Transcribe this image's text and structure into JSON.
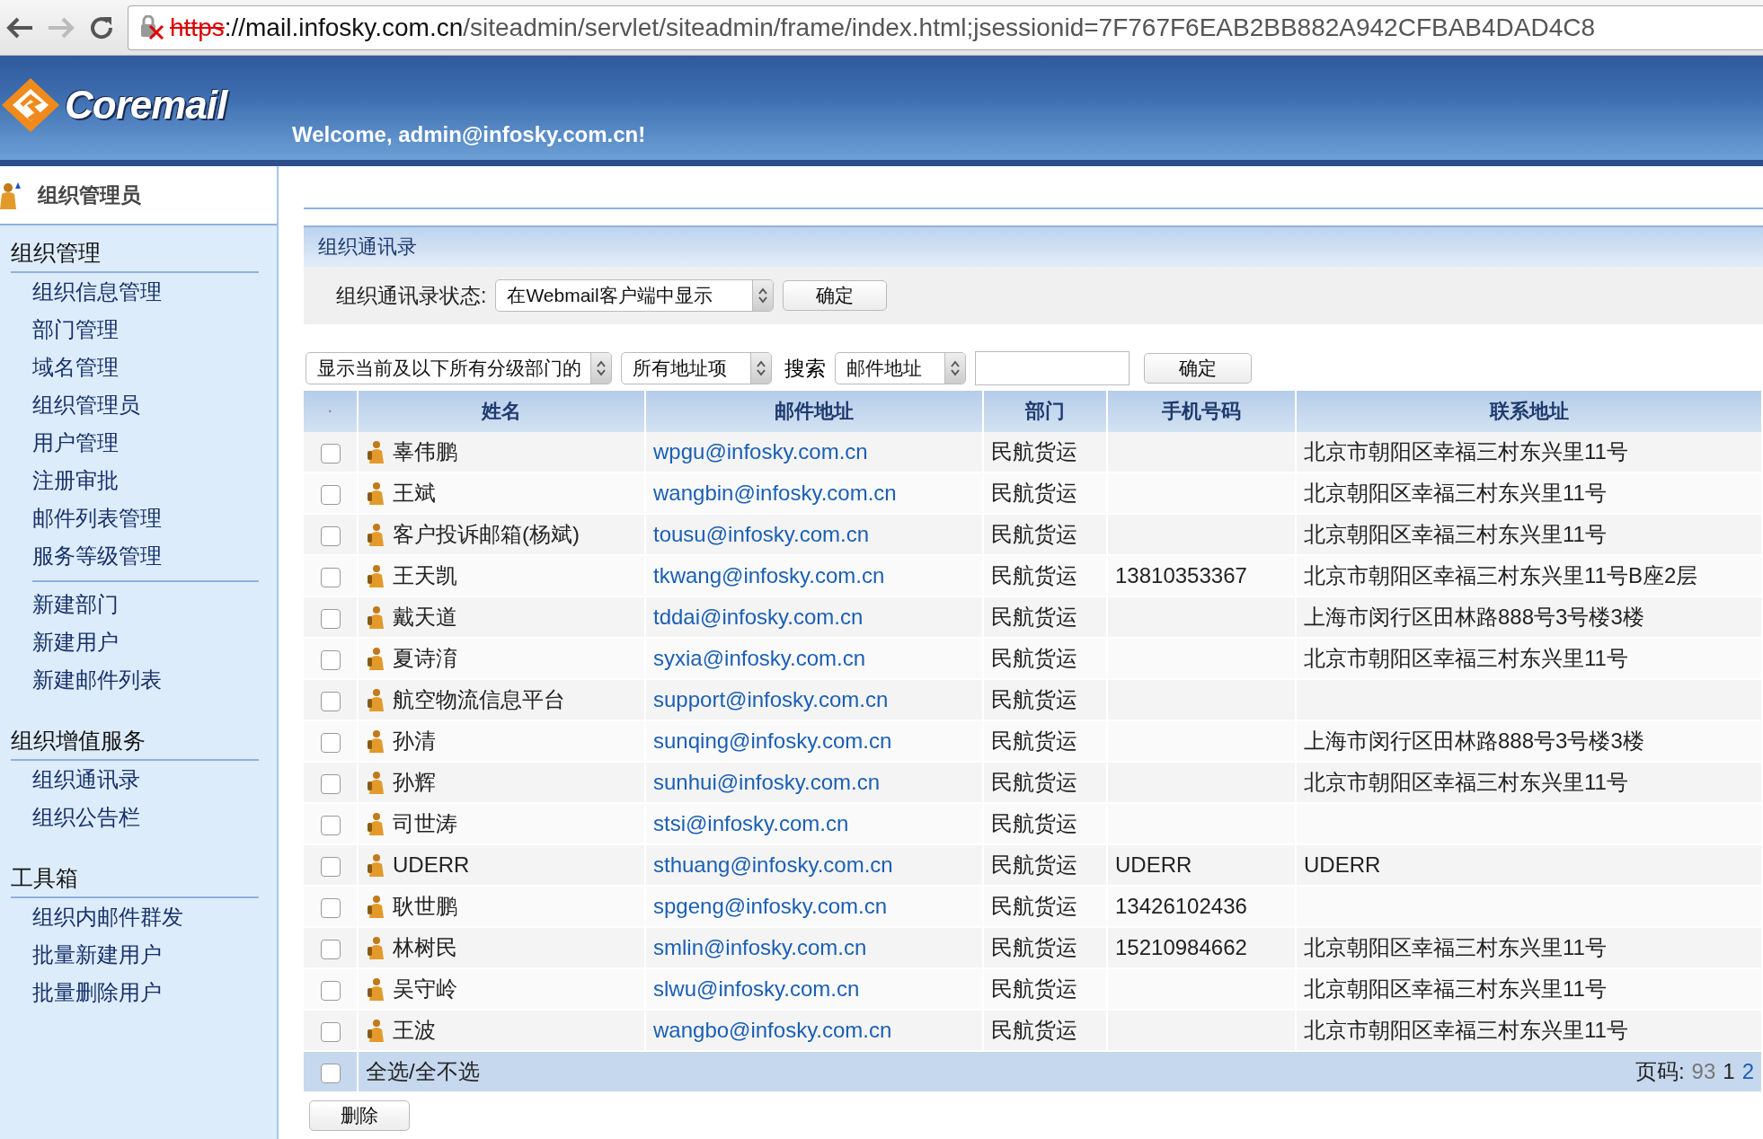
{
  "browser": {
    "url_scheme": "https",
    "url_host": "://mail.infosky.com.cn",
    "url_path": "/siteadmin/servlet/siteadmin/frame/index.html;jsessionid=7F767F6EAB2BB882A942CFBAB4DAD4C8"
  },
  "header": {
    "logo": "Coremail",
    "welcome": "Welcome, admin@infosky.com.cn!"
  },
  "sidebar": {
    "role": "组织管理员",
    "groups": [
      {
        "title": "组织管理",
        "items": [
          {
            "label": "组织信息管理"
          },
          {
            "label": "部门管理"
          },
          {
            "label": "域名管理"
          },
          {
            "label": "组织管理员"
          },
          {
            "label": "用户管理"
          },
          {
            "label": "注册审批"
          },
          {
            "label": "邮件列表管理"
          },
          {
            "label": "服务等级管理"
          }
        ],
        "items2": [
          {
            "label": "新建部门"
          },
          {
            "label": "新建用户"
          },
          {
            "label": "新建邮件列表"
          }
        ]
      },
      {
        "title": "组织增值服务",
        "items": [
          {
            "label": "组织通讯录"
          },
          {
            "label": "组织公告栏"
          }
        ]
      },
      {
        "title": "工具箱",
        "items": [
          {
            "label": "组织内邮件群发"
          },
          {
            "label": "批量新建用户"
          },
          {
            "label": "批量删除用户"
          }
        ]
      }
    ]
  },
  "panel": {
    "title": "组织通讯录",
    "status_label": "组织通讯录状态:",
    "status_value": "在Webmail客户端中显示",
    "status_button": "确定"
  },
  "filters": {
    "scope": "显示当前及以下所有分级部门的",
    "fields": "所有地址项",
    "search_label": "搜索",
    "search_by": "邮件地址",
    "search_button": "确定"
  },
  "table": {
    "columns": [
      "·",
      "姓名",
      "邮件地址",
      "部门",
      "手机号码",
      "联系地址"
    ],
    "rows": [
      {
        "checked": false,
        "name": "辜伟鹏",
        "email": "wpgu@infosky.com.cn",
        "dept": "民航货运",
        "phone": "",
        "address": "北京市朝阳区幸福三村东兴里11号"
      },
      {
        "checked": false,
        "name": "王斌",
        "email": "wangbin@infosky.com.cn",
        "dept": "民航货运",
        "phone": "",
        "address": "北京朝阳区幸福三村东兴里11号"
      },
      {
        "checked": false,
        "name": "客户投诉邮箱(杨斌)",
        "email": "tousu@infosky.com.cn",
        "dept": "民航货运",
        "phone": "",
        "address": "北京朝阳区幸福三村东兴里11号"
      },
      {
        "checked": false,
        "name": "王天凯",
        "email": "tkwang@infosky.com.cn",
        "dept": "民航货运",
        "phone": "13810353367",
        "address": "北京市朝阳区幸福三村东兴里11号B座2层"
      },
      {
        "checked": false,
        "name": "戴天道",
        "email": "tddai@infosky.com.cn",
        "dept": "民航货运",
        "phone": "",
        "address": "上海市闵行区田林路888号3号楼3楼"
      },
      {
        "checked": false,
        "name": "夏诗淯",
        "email": "syxia@infosky.com.cn",
        "dept": "民航货运",
        "phone": "",
        "address": "北京市朝阳区幸福三村东兴里11号"
      },
      {
        "checked": false,
        "name": "航空物流信息平台",
        "email": "support@infosky.com.cn",
        "dept": "民航货运",
        "phone": "",
        "address": ""
      },
      {
        "checked": false,
        "name": "孙清",
        "email": "sunqing@infosky.com.cn",
        "dept": "民航货运",
        "phone": "",
        "address": "上海市闵行区田林路888号3号楼3楼"
      },
      {
        "checked": false,
        "name": "孙辉",
        "email": "sunhui@infosky.com.cn",
        "dept": "民航货运",
        "phone": "",
        "address": "北京市朝阳区幸福三村东兴里11号"
      },
      {
        "checked": false,
        "name": "司世涛",
        "email": "stsi@infosky.com.cn",
        "dept": "民航货运",
        "phone": "",
        "address": ""
      },
      {
        "checked": false,
        "name": "UDERR",
        "email": "sthuang@infosky.com.cn",
        "dept": "民航货运",
        "phone": "UDERR",
        "address": "UDERR"
      },
      {
        "checked": false,
        "name": "耿世鹏",
        "email": "spgeng@infosky.com.cn",
        "dept": "民航货运",
        "phone": "13426102436",
        "address": ""
      },
      {
        "checked": false,
        "name": "林树民",
        "email": "smlin@infosky.com.cn",
        "dept": "民航货运",
        "phone": "15210984662",
        "address": "北京朝阳区幸福三村东兴里11号"
      },
      {
        "checked": false,
        "name": "吴守岭",
        "email": "slwu@infosky.com.cn",
        "dept": "民航货运",
        "phone": "",
        "address": "北京朝阳区幸福三村东兴里11号"
      },
      {
        "checked": false,
        "name": "王波",
        "email": "wangbo@infosky.com.cn",
        "dept": "民航货运",
        "phone": "",
        "address": "北京市朝阳区幸福三村东兴里11号"
      }
    ],
    "footer": {
      "checked": false,
      "select_all": "全选/全不选",
      "page_label": "页码:",
      "total": "93",
      "pages": [
        {
          "label": "1",
          "selected": true
        },
        {
          "label": "2",
          "selected": false
        }
      ]
    }
  },
  "delete_button": "删除"
}
